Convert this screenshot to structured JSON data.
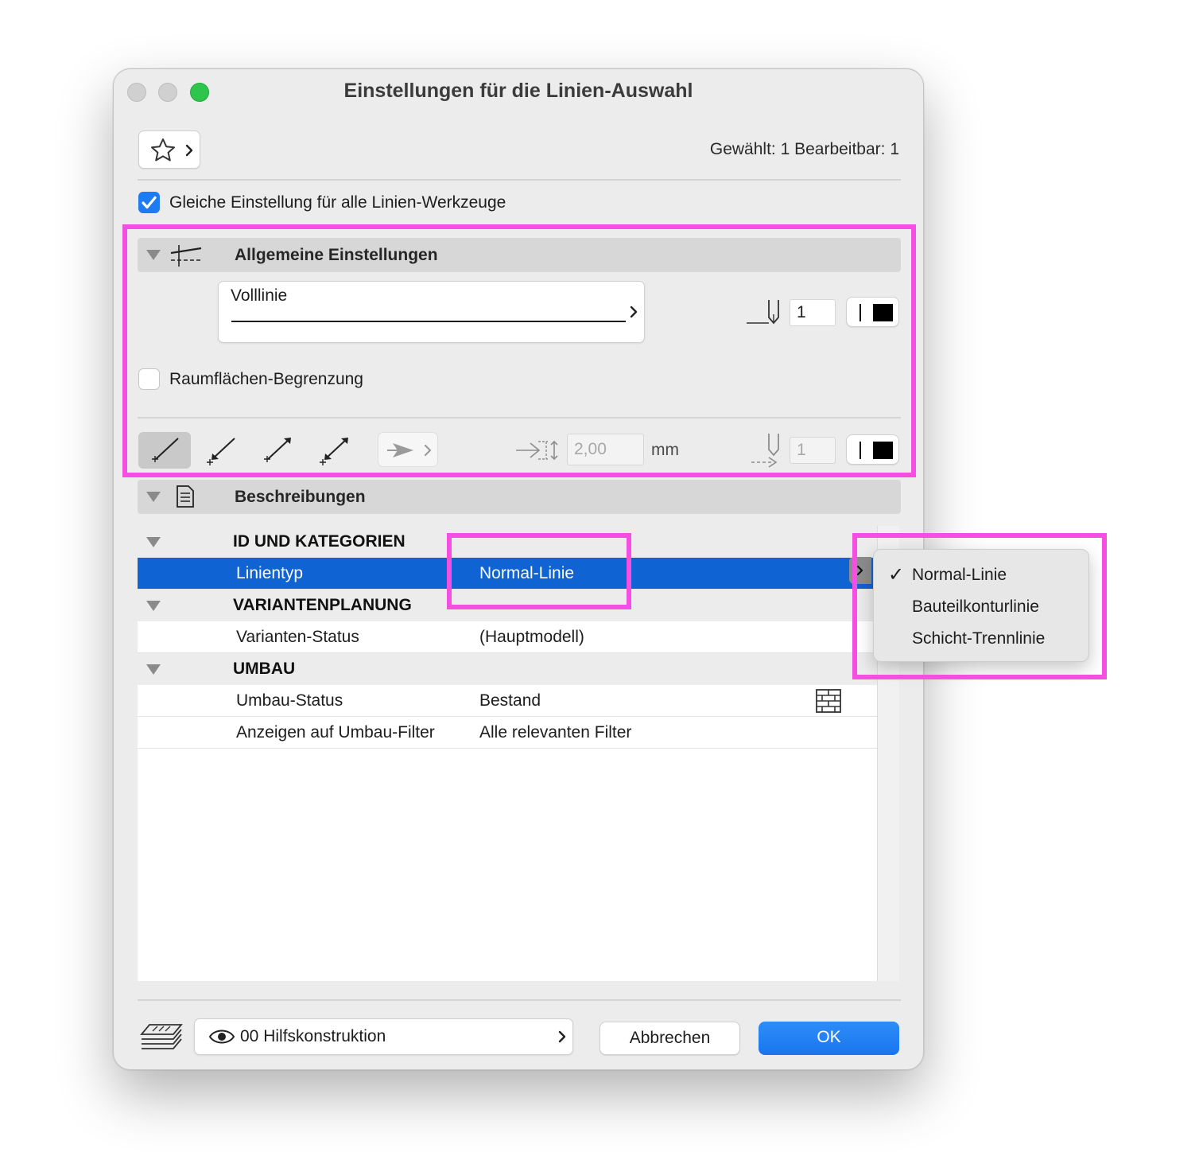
{
  "window": {
    "title": "Einstellungen für die Linien-Auswahl",
    "selection_count": "Gewählt: 1 Bearbeitbar: 1"
  },
  "same_settings": {
    "label": "Gleiche Einstellung für alle Linien-Werkzeuge",
    "checked": true
  },
  "general": {
    "title": "Allgemeine Einstellungen",
    "line_type": "Volllinie",
    "pen_value": "1",
    "room_boundary": {
      "label": "Raumflächen-Begrenzung",
      "checked": false
    },
    "arrow_size_value": "2,00",
    "arrow_size_unit": "mm",
    "arrow_pen_value": "1"
  },
  "descriptions": {
    "title": "Beschreibungen",
    "groups": [
      {
        "name": "ID UND KATEGORIEN",
        "rows": [
          {
            "name": "Linientyp",
            "value": "Normal-Linie",
            "selected": true
          }
        ]
      },
      {
        "name": "VARIANTENPLANUNG",
        "rows": [
          {
            "name": "Varianten-Status",
            "value": "(Hauptmodell)"
          }
        ]
      },
      {
        "name": "UMBAU",
        "rows": [
          {
            "name": "Umbau-Status",
            "value": "Bestand"
          },
          {
            "name": "Anzeigen auf Umbau-Filter",
            "value": "Alle relevanten Filter"
          }
        ]
      }
    ]
  },
  "popup": {
    "checkmark": "✓",
    "items": [
      "Normal-Linie",
      "Bauteilkonturlinie",
      "Schicht-Trennlinie"
    ],
    "selected_index": 0
  },
  "footer": {
    "layer": "00 Hilfskonstruktion",
    "cancel": "Abbrechen",
    "ok": "OK"
  },
  "colors": {
    "accent": "#1f7bf2",
    "selection": "#0f63d2",
    "highlight": "#f44ee2",
    "close": "#d0d0d0",
    "zoom": "#2dc54c"
  }
}
